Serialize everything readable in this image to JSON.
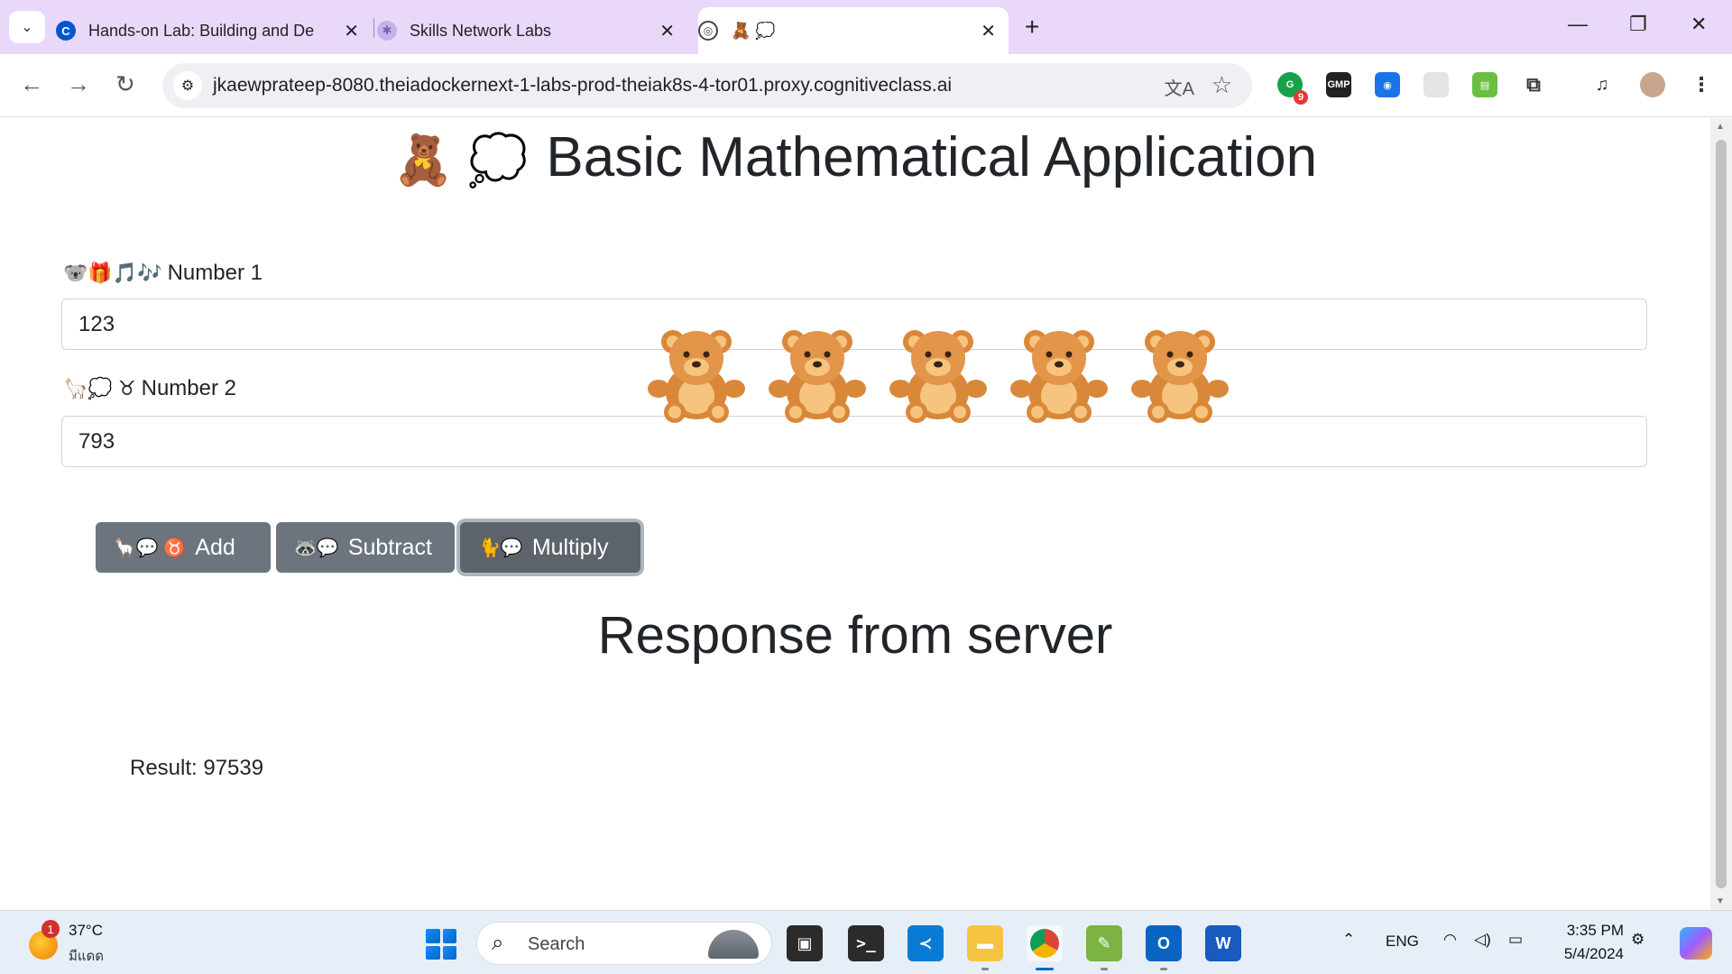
{
  "browser": {
    "tabs": [
      {
        "title": "Hands-on Lab: Building and De",
        "favicon": "coursera-icon"
      },
      {
        "title": "Skills Network Labs",
        "favicon": "skills-network-icon"
      },
      {
        "title": "🧸 💭",
        "favicon": "globe-icon"
      }
    ],
    "url": "jkaewprateep-8080.theiadockernext-1-labs-prod-theiak8s-4-tor01.proxy.cognitiveclass.ai",
    "extensions": [
      {
        "name": "grammarly-icon",
        "badge": "9",
        "color": "#15a34a"
      },
      {
        "name": "gmp-icon",
        "label": "GMP",
        "color": "#222222"
      },
      {
        "name": "camera-icon",
        "color": "#1a73e8"
      },
      {
        "name": "puzzle-ext-icon",
        "color": "#dddddd"
      },
      {
        "name": "green-ext-icon",
        "color": "#6abf40"
      }
    ]
  },
  "page": {
    "title_emoji": "🧸 💭",
    "title": "Basic Mathematical Application",
    "number1": {
      "emoji": "🐨🎁🎵🎶",
      "label": "Number 1",
      "value": "123"
    },
    "number2": {
      "emoji": "🦙💭 ♉",
      "label": "Number 2",
      "value": "793"
    },
    "bears": [
      "🧸",
      "🧸",
      "🧸",
      "🧸",
      "🧸"
    ],
    "buttons": {
      "add": {
        "emoji": "🦙💬 ♉",
        "label": "Add"
      },
      "subtract": {
        "emoji": "🦝💬",
        "label": "Subtract"
      },
      "multiply": {
        "emoji": "🐈💬",
        "label": "Multiply"
      }
    },
    "response_title": "Response from server",
    "result": "Result: 97539"
  },
  "taskbar": {
    "weather": {
      "temp": "37°C",
      "desc": "มีแดด",
      "badge": "1"
    },
    "search_placeholder": "Search",
    "language": "ENG",
    "time": "3:35 PM",
    "date": "5/4/2024"
  }
}
